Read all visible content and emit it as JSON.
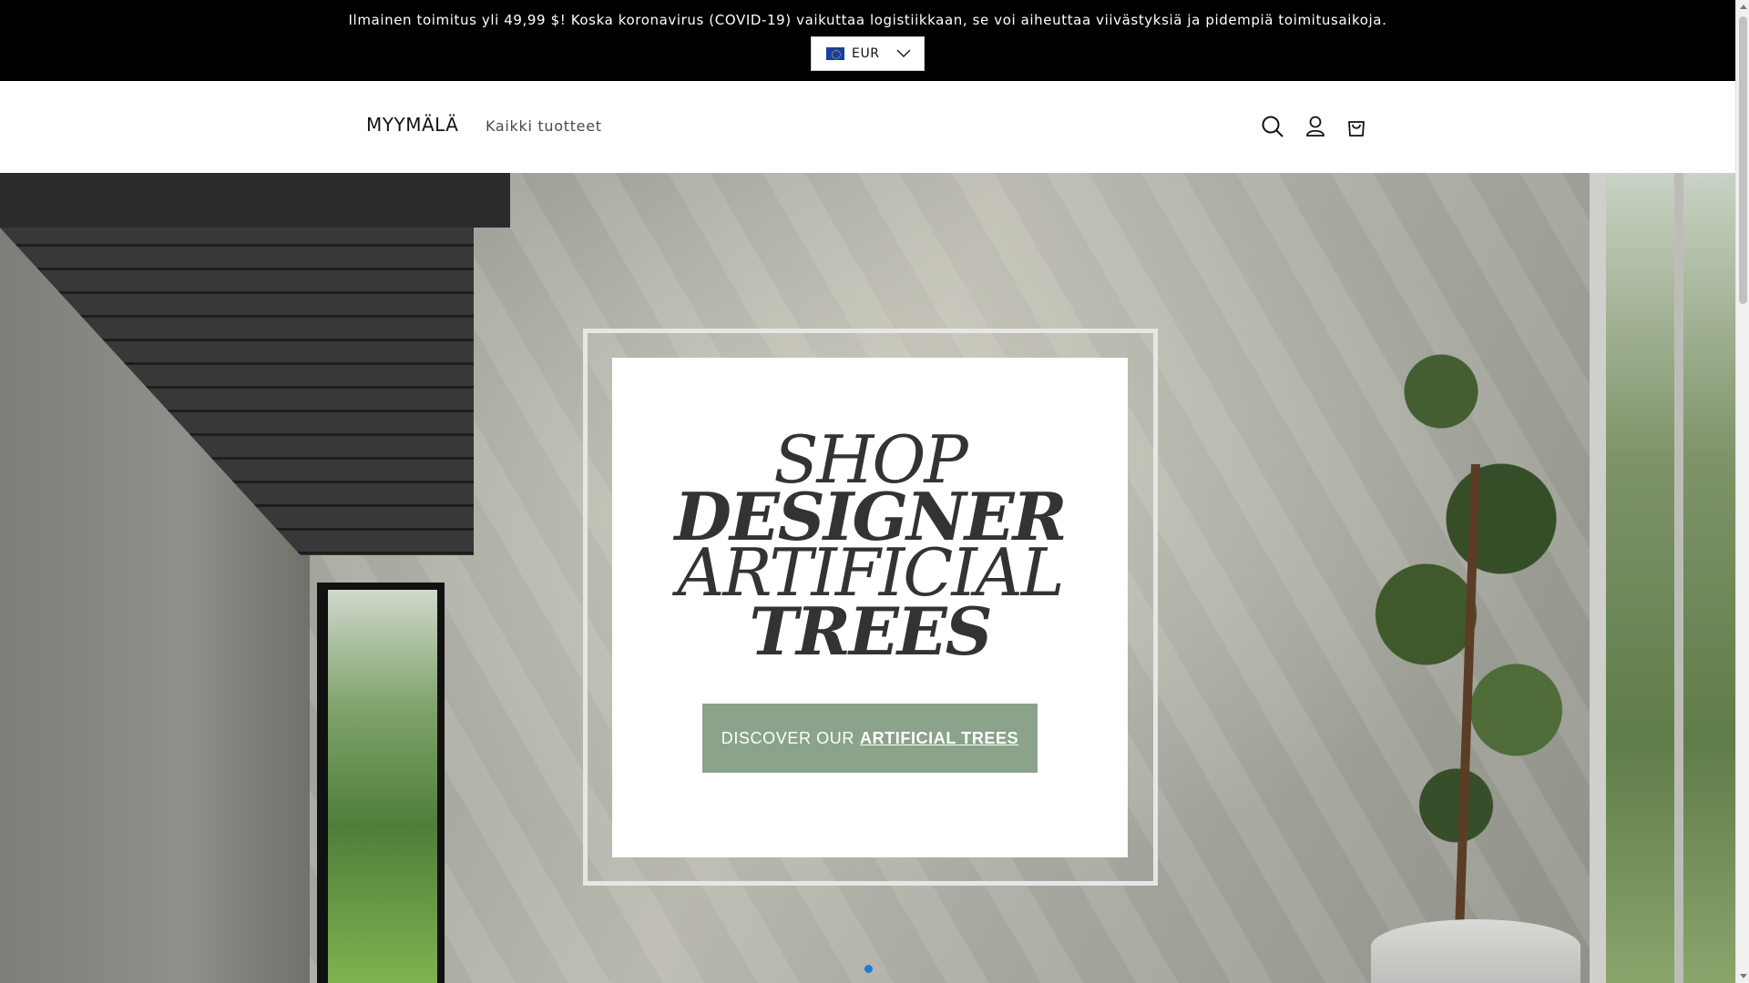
{
  "announcement": {
    "text": "Ilmainen toimitus yli 49,99 $! Koska koronavirus (COVID-19) vaikuttaa logistiikkaan, se voi aiheuttaa viivästyksiä ja pidempiä toimitusaikoja."
  },
  "currency": {
    "selected": "EUR",
    "flag_icon": "eu-flag-icon"
  },
  "header": {
    "logo": "MYYMÄLÄ",
    "nav_all_products": "Kaikki tuotteet",
    "icons": [
      "search-icon",
      "account-icon",
      "cart-icon"
    ]
  },
  "hero": {
    "promo_lines": [
      "SHOP",
      "DESIGNER",
      "ARTIFICIAL",
      "TREES"
    ],
    "cta_prefix": "DISCOVER OUR",
    "cta_emphasis": "ARTIFICIAL TREES",
    "cta_color": "#8aa38a",
    "active_slide_color": "#1f7ae0"
  },
  "colors": {
    "announcement_bg": "#000000",
    "text": "#121212"
  }
}
